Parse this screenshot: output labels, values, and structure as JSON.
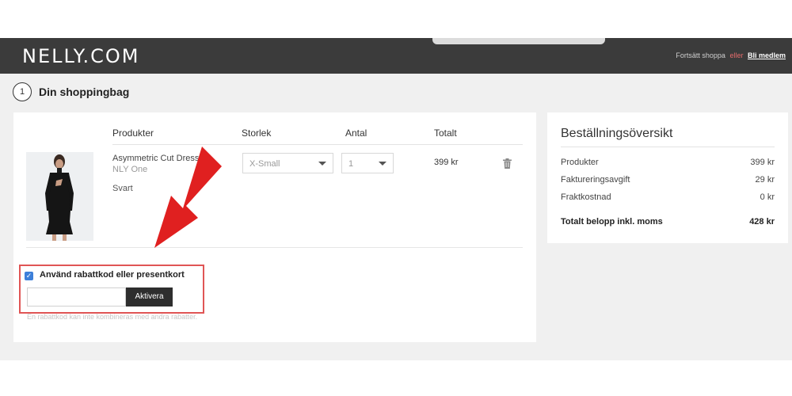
{
  "header": {
    "logo": "NELLY.COM",
    "continue_shopping": "Fortsätt shoppa",
    "or": "eller",
    "become_member": "Bli medlem"
  },
  "step": {
    "number": "1",
    "title": "Din shoppingbag"
  },
  "cart": {
    "columns": {
      "product": "Produkter",
      "size": "Storlek",
      "quantity": "Antal",
      "total": "Totalt"
    },
    "item": {
      "name": "Asymmetric Cut Dress",
      "brand": "NLY One",
      "color": "Svart",
      "size_value": "X-Small",
      "quantity_value": "1",
      "total": "399 kr"
    }
  },
  "discount": {
    "checked": true,
    "label": "Använd rabattkod eller presentkort",
    "input_value": "",
    "button": "Aktivera",
    "note": "En rabattkod kan inte kombineras med andra rabatter."
  },
  "summary": {
    "title": "Beställningsöversikt",
    "rows": [
      {
        "label": "Produkter",
        "value": "399 kr"
      },
      {
        "label": "Faktureringsavgift",
        "value": "29 kr"
      },
      {
        "label": "Fraktkostnad",
        "value": "0 kr"
      }
    ],
    "total_label": "Totalt belopp inkl. moms",
    "total_value": "428 kr"
  },
  "colors": {
    "topbar": "#3b3b3b",
    "highlight": "#e05555",
    "arrow": "#e02020",
    "checkbox": "#3d7fd9"
  }
}
